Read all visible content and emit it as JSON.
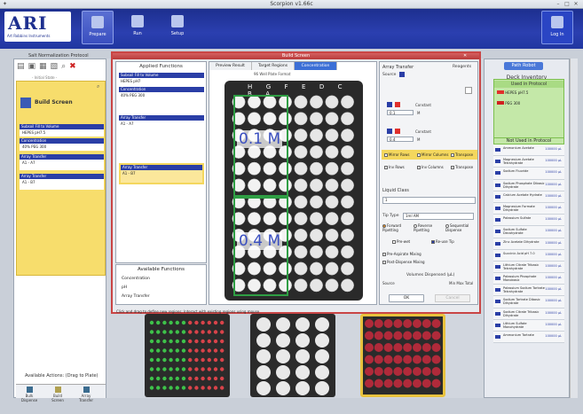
{
  "window": {
    "title": "Scorpion v1.66c"
  },
  "header": {
    "logo_text": "ARI",
    "logo_sub": "Art Robbins Instruments",
    "buttons": [
      {
        "label": "Prepare",
        "icon": "prepare-icon"
      },
      {
        "label": "Run",
        "icon": "run-icon"
      },
      {
        "label": "Setup",
        "icon": "setup-icon"
      }
    ],
    "login": {
      "label": "Log In",
      "icon": "lock-icon"
    }
  },
  "protocol": {
    "title": "Salt Normalization Protocol",
    "initial_state": "- Initial State -",
    "step_label": "Build Screen",
    "steps": [
      {
        "bar": "Subsoil Fill to Volume",
        "row": "HEPES pH7.5"
      },
      {
        "bar": "Concentration",
        "row": "40% PEG 300"
      },
      {
        "bar": "Array Transfer",
        "row": "A1 - A7"
      },
      {
        "bar": "Array Transfer",
        "row": "A1 - B7"
      }
    ],
    "available_actions_title": "Available Actions: (Drag to Plate)",
    "actions": [
      "Bulk Dispense",
      "Build Screen",
      "Array Transfer"
    ]
  },
  "modal": {
    "title": "Build Screen",
    "applied_title": "Applied Functions",
    "applied": [
      {
        "bar": "Subsoil Fill to Volume",
        "extra": "HEPES pH7",
        "highlight": false
      },
      {
        "bar": "Concentration",
        "extra": "40% PEG 300",
        "highlight": false
      },
      {
        "bar": "Array Transfer",
        "extra": "A1 - A7",
        "highlight": false
      },
      {
        "bar": "Array Transfer",
        "extra": "A1 - B7",
        "highlight": true
      }
    ],
    "available_title": "Available Functions",
    "available": [
      "Concentration",
      "pH",
      "Array Transfer"
    ],
    "tabs": [
      "Preview Result",
      "Target Regions",
      "Concentration"
    ],
    "rf_info": "96 Well Plate Format",
    "columns": "H G F E D C B A",
    "regions": [
      {
        "label": "0.1 M"
      },
      {
        "label": "0.4 M"
      }
    ],
    "hint": "Click and drag to define new regions; Interact with existing regions using mouse",
    "array_transfer_title": "Array Transfer",
    "reagents_label": "Reagents",
    "source_label": "Source",
    "constant_label": "Constant",
    "val1": "0.1",
    "val2": "0.4",
    "unit": "M",
    "mirror_opts": [
      "Mirror Rows",
      "Mirror Columns",
      "Transpose"
    ],
    "inv_opts": [
      "Inv Rows",
      "Inv Columns",
      "Transpose"
    ],
    "liquid_class_title": "Liquid Class",
    "liquid_class_value": "1",
    "tip_type_label": "Tip Type",
    "tip_type_value": "1ml AM",
    "pipetting": [
      "Forward Pipetting",
      "Reverse Pipetting",
      "Sequential Dispense"
    ],
    "prewet": "Pre-wet",
    "reuse_tip": "Re-use Tip",
    "pre_asp": "Pre-Aspirate Mixing",
    "post_disp": "Post-Dispense Mixing",
    "volumes_title": "Volumes Dispensed (µL)",
    "source_col": "Source",
    "minmax": "Min Max Total",
    "ok": "OK",
    "cancel": "Cancel"
  },
  "deck": {
    "path_robot": "Path Robot",
    "inventory_title": "Deck Inventory",
    "used_title": "Used in Protocol",
    "used": [
      {
        "name": "HEPES pH7.5",
        "color": "#e0302c"
      },
      {
        "name": "PEG 300",
        "color": "#d02020"
      }
    ],
    "not_used_title": "Not Used in Protocol",
    "items": [
      {
        "name": "Ammonium Acetate",
        "qty": "100000 µL"
      },
      {
        "name": "Magnesium Acetate Tetrahydrate",
        "qty": "100000 µL"
      },
      {
        "name": "Sodium Fluoride",
        "qty": "100000 µL"
      },
      {
        "name": "Sodium Phosphate Dibasic Dihydrate",
        "qty": "100000 µL"
      },
      {
        "name": "Calcium Acetate Hydrate",
        "qty": "100000 µL"
      },
      {
        "name": "Magnesium Formate Dihydrate",
        "qty": "100000 µL"
      },
      {
        "name": "Potassium Sulfate",
        "qty": "100000 µL"
      },
      {
        "name": "Sodium Sulfate Decahydrate",
        "qty": "100000 µL"
      },
      {
        "name": "Zinc Acetate Dihydrate",
        "qty": "100000 µL"
      },
      {
        "name": "Succinic Acid pH 7.0",
        "qty": "100000 µL"
      },
      {
        "name": "Lithium Citrate Tribasic Tetrahydrate",
        "qty": "100000 µL"
      },
      {
        "name": "Potassium Phosphate Monobasic",
        "qty": "100000 µL"
      },
      {
        "name": "Potassium Sodium Tartrate Tetrahydrate",
        "qty": "100000 µL"
      },
      {
        "name": "Sodium Tartrate Dibasic Dihydrate",
        "qty": "100000 µL"
      },
      {
        "name": "Sodium Citrate Tribasic Dihydrate",
        "qty": "100000 µL"
      },
      {
        "name": "Lithium Sulfate Monohydrate",
        "qty": "100000 µL"
      },
      {
        "name": "Ammonium Tartrate",
        "qty": "100000 µL"
      }
    ]
  }
}
